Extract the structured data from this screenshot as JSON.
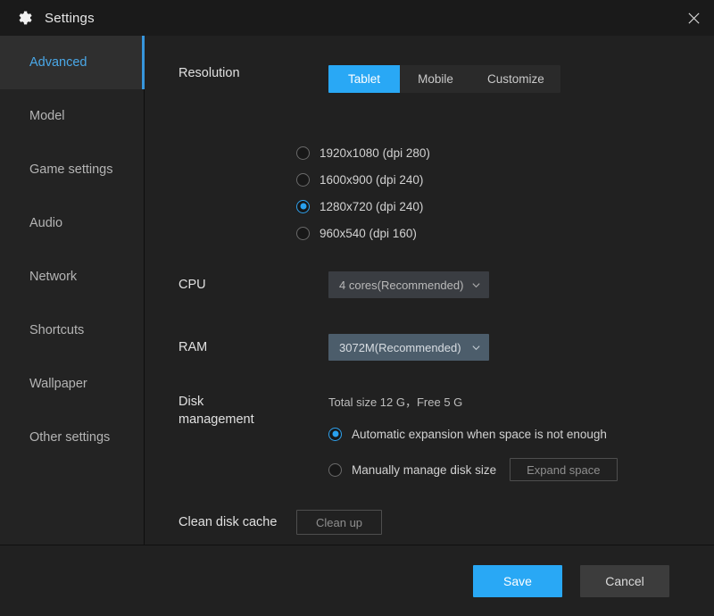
{
  "window": {
    "title": "Settings",
    "gear_icon": "gear-icon",
    "close_icon": "close-icon",
    "accent_color": "#29a8f5",
    "background_color": "#212121"
  },
  "sidebar": {
    "items": [
      {
        "label": "Advanced",
        "active": true
      },
      {
        "label": "Model",
        "active": false
      },
      {
        "label": "Game settings",
        "active": false
      },
      {
        "label": "Audio",
        "active": false
      },
      {
        "label": "Network",
        "active": false
      },
      {
        "label": "Shortcuts",
        "active": false
      },
      {
        "label": "Wallpaper",
        "active": false
      },
      {
        "label": "Other settings",
        "active": false
      }
    ]
  },
  "main": {
    "resolution": {
      "label": "Resolution",
      "tabs": [
        {
          "label": "Tablet",
          "active": true
        },
        {
          "label": "Mobile",
          "active": false
        },
        {
          "label": "Customize",
          "active": false
        }
      ],
      "options": [
        {
          "label": "1920x1080  (dpi 280)",
          "selected": false
        },
        {
          "label": "1600x900  (dpi 240)",
          "selected": false
        },
        {
          "label": "1280x720  (dpi 240)",
          "selected": true
        },
        {
          "label": "960x540  (dpi 160)",
          "selected": false
        }
      ]
    },
    "cpu": {
      "label": "CPU",
      "value": "4 cores(Recommended)",
      "chevron_icon": "chevron-down-icon"
    },
    "ram": {
      "label": "RAM",
      "value": "3072M(Recommended)",
      "chevron_icon": "chevron-down-icon"
    },
    "disk": {
      "label_line1": "Disk",
      "label_line2": "management",
      "info": "Total size 12 G，Free 5 G",
      "auto_option": "Automatic expansion when space is not enough",
      "auto_selected": true,
      "manual_option": "Manually manage disk size",
      "manual_selected": false,
      "expand_button": "Expand space"
    },
    "clean": {
      "label": "Clean disk cache",
      "button": "Clean up"
    }
  },
  "footer": {
    "save": "Save",
    "cancel": "Cancel"
  }
}
